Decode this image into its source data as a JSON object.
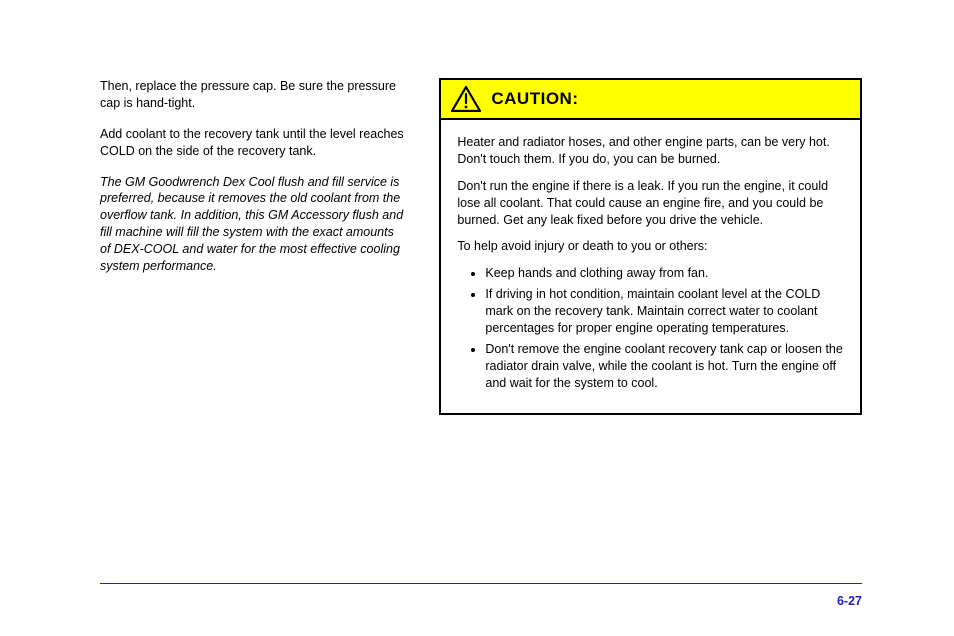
{
  "left": {
    "p1": "Then, replace the pressure cap. Be sure the pressure cap is hand-tight.",
    "p2": "Add coolant to the recovery tank until the level reaches COLD on the side of the recovery tank.",
    "p3_italic": "The GM Goodwrench Dex Cool flush and fill service is preferred, because it removes the old coolant from the overflow tank. In addition, this GM Accessory flush and fill machine will fill the system with the exact amounts of DEX-COOL and water for the most effective cooling system performance."
  },
  "caution": {
    "title": "CAUTION:",
    "p1": "Heater and radiator hoses, and other engine parts, can be very hot. Don't touch them. If you do, you can be burned.",
    "p2": "Don't run the engine if there is a leak. If you run the engine, it could lose all coolant. That could cause an engine fire, and you could be burned. Get any leak fixed before you drive the vehicle.",
    "p3": "To help avoid injury or death to you or others:",
    "bullets": [
      "Keep hands and clothing away from fan.",
      "If driving in hot condition, maintain coolant level at the COLD mark on the recovery tank. Maintain correct water to coolant percentages for proper engine operating temperatures.",
      "Don't remove the engine coolant recovery tank cap or loosen the radiator drain valve, while the coolant is hot. Turn the engine off and wait for the system to cool."
    ]
  },
  "footer": {
    "pageNumber": "6-27"
  }
}
